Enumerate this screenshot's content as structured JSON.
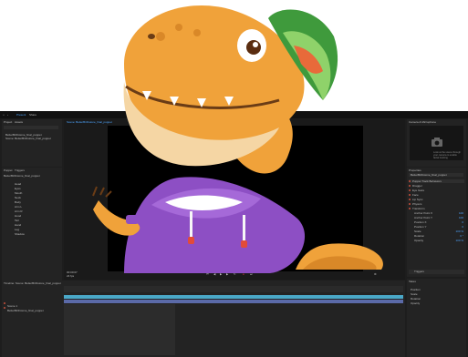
{
  "menu": {
    "tabs": [
      "Present",
      "Share"
    ]
  },
  "left_panel": {
    "tabs": [
      "Project",
      "Assets"
    ],
    "search_placeholder": "",
    "items": [
      "BetterBirthstone_final_puppet",
      "Scene: BetterBirthstone_final_puppet"
    ],
    "puppet_tabs": [
      "Puppet",
      "Triggers"
    ],
    "puppet_title": "BetterBirthstone_final_puppet",
    "layers": [
      "Head",
      "Eyes",
      "Mouth",
      "Neck",
      "Body",
      "Arm L",
      "Arm R",
      "Hood",
      "Tail",
      "Hand",
      "Leg",
      "Shadow"
    ]
  },
  "center": {
    "tab": "Scene: BetterBirthstone_final_puppet",
    "timecode": "00:00:07",
    "fps": "24 fps"
  },
  "right_panel": {
    "camera_tab": "Camera & Microphone",
    "camera_text": "Look at the scene through your camera to enable facial tracking",
    "properties_tab": "Properties",
    "puppet_name": "BetterBirthstone_final_puppet",
    "sections": [
      "Puppet Track Behaviors",
      "Dragger",
      "Eye Gaze",
      "Face",
      "Lip Sync",
      "Physics",
      "Transform"
    ],
    "params": [
      "Anchor Point X",
      "Anchor Point Y",
      "Position X",
      "Position Y",
      "Scale",
      "Rotation",
      "Opacity"
    ],
    "values": [
      "100",
      "100",
      "0",
      "0",
      "100 %",
      "0 °",
      "100 %"
    ],
    "triggers_label": "Triggers"
  },
  "timeline": {
    "tab": "Timeline: Scene: BetterBirthstone_final_puppet",
    "tracks": [
      "Scene 1",
      "BetterBirthstone_final_puppet"
    ]
  },
  "bottom_right": {
    "title": "Takes",
    "rows": [
      "Position",
      "Scale",
      "Rotation",
      "Opacity"
    ]
  },
  "colors": {
    "accent": "#4ea5ff",
    "track_bar": "#4aa8c8",
    "track_bar2": "#5b6aa8",
    "dino_body": "#f0a23a",
    "hoodie": "#8d4fc4",
    "cap": "#3f9a3c"
  }
}
